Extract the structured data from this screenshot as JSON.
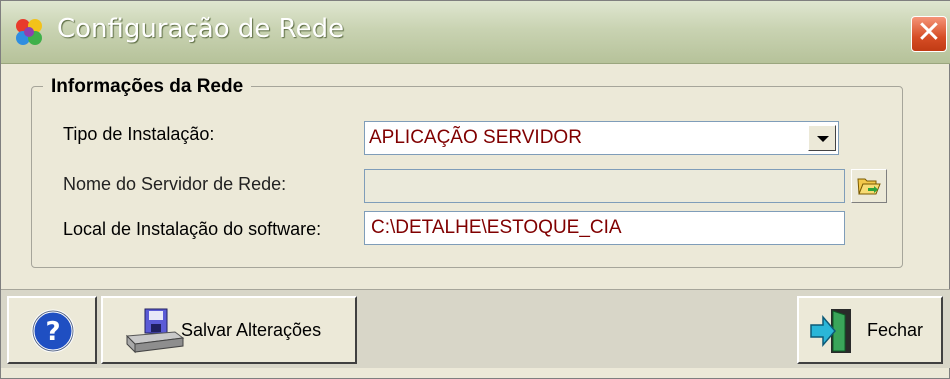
{
  "window": {
    "title": "Configuração de Rede",
    "close_symbol": "✕"
  },
  "group": {
    "title": "Informações da Rede"
  },
  "fields": {
    "install_type": {
      "label": "Tipo de Instalação:",
      "value": "APLICAÇÃO SERVIDOR"
    },
    "server_name": {
      "label": "Nome do Servidor de Rede:",
      "value": ""
    },
    "install_path": {
      "label": "Local de Instalação do software:",
      "value": "C:\\DETALHE\\ESTOQUE_CIA"
    }
  },
  "toolbar": {
    "help_symbol": "?",
    "save_label": "Salvar Alterações",
    "close_label": "Fechar"
  },
  "icons": {
    "app": "app-icon",
    "close": "close-icon",
    "dropdown": "chevron-down-icon",
    "browse": "folder-open-icon",
    "help": "help-icon",
    "save": "save-disk-icon",
    "exit": "exit-door-icon"
  },
  "colors": {
    "field_text": "#800000",
    "title_bar": "#c9d3b2",
    "close_button": "#d64d25",
    "help_button": "#1f4fc2"
  }
}
